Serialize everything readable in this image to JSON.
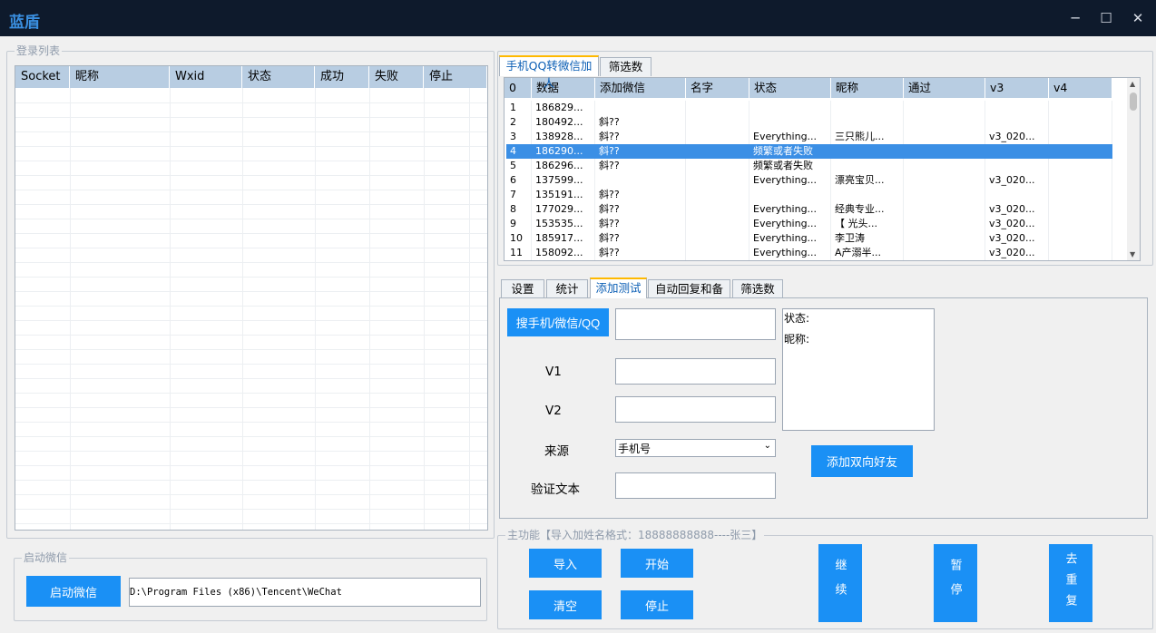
{
  "window": {
    "title": "蓝盾",
    "minimize": "─",
    "maximize": "☐",
    "close": "✕"
  },
  "login_panel": {
    "label": "登录列表",
    "columns": [
      "Socket",
      "昵称",
      "Wxid",
      "状态",
      "成功",
      "失败",
      "停止"
    ]
  },
  "launch_panel": {
    "label": "启动微信",
    "button": "启动微信",
    "path": "D:\\Program Files (x86)\\Tencent\\WeChat"
  },
  "top_tabs": [
    "手机QQ转微信加人",
    "筛选数据"
  ],
  "data_table": {
    "columns": [
      "0",
      "数据",
      "添加微信",
      "名字",
      "状态",
      "昵称",
      "通过",
      "v3",
      "v4"
    ],
    "rows": [
      [
        "1",
        "186829...",
        "",
        "",
        "",
        "",
        "",
        "",
        ""
      ],
      [
        "2",
        "180492...",
        "斜??",
        "",
        "",
        "",
        "",
        "",
        ""
      ],
      [
        "3",
        "138928...",
        "斜??",
        "",
        "Everything...",
        "三只熊儿...",
        "",
        "v3_020...",
        ""
      ],
      [
        "4",
        "186290...",
        "斜??",
        "",
        "频繁或者失败",
        "",
        "",
        "",
        ""
      ],
      [
        "5",
        "186296...",
        "斜??",
        "",
        "频繁或者失败",
        "",
        "",
        "",
        ""
      ],
      [
        "6",
        "137599...",
        "",
        "",
        "Everything...",
        "漂亮宝贝...",
        "",
        "v3_020...",
        ""
      ],
      [
        "7",
        "135191...",
        "斜??",
        "",
        "",
        "",
        "",
        "",
        ""
      ],
      [
        "8",
        "177029...",
        "斜??",
        "",
        "Everything...",
        "经典专业...",
        "",
        "v3_020...",
        ""
      ],
      [
        "9",
        "153535...",
        "斜??",
        "",
        "Everything...",
        "【 光头...",
        "",
        "v3_020...",
        ""
      ],
      [
        "10",
        "185917...",
        "斜??",
        "",
        "Everything...",
        "李卫涛",
        "",
        "v3_020...",
        ""
      ],
      [
        "11",
        "158092...",
        "斜??",
        "",
        "Everything...",
        "A产溺半...",
        "",
        "v3_020...",
        ""
      ]
    ],
    "selected_row": "4"
  },
  "bottom_tabs": [
    "设置",
    "统计",
    "添加测试",
    "自动回复和备注",
    "筛选数据"
  ],
  "test_panel": {
    "search_button": "搜手机/微信/QQ",
    "v1_label": "V1",
    "v2_label": "V2",
    "source_label": "来源",
    "source_value": "手机号",
    "verify_label": "验证文本",
    "status_label": "状态:",
    "nickname_label": "昵称:",
    "add_button": "添加双向好友"
  },
  "main_panel": {
    "label": "主功能【导入加姓名格式：18888888888----张三】",
    "import": "导入",
    "start": "开始",
    "clear": "清空",
    "stop": "停止",
    "continue": "继续",
    "pause": "暂停",
    "dedupe": "去重复"
  }
}
